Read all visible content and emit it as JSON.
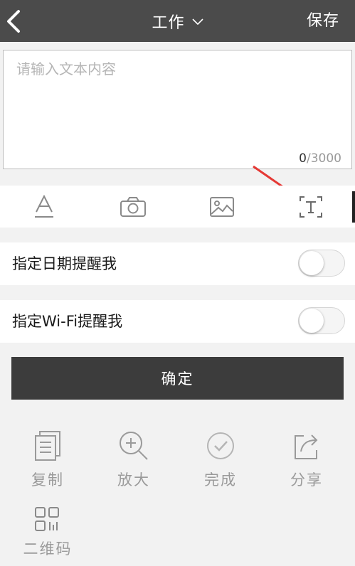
{
  "header": {
    "back_icon": "back-arrow-icon",
    "title": "工作",
    "title_dropdown_icon": "chevron-down-icon",
    "save_label": "保存"
  },
  "editor": {
    "placeholder": "请输入文本内容",
    "value": "",
    "counter_current": "0",
    "counter_max": "/3000"
  },
  "toolbar": {
    "items": [
      {
        "icon": "text-format-icon"
      },
      {
        "icon": "camera-icon"
      },
      {
        "icon": "image-icon"
      },
      {
        "icon": "text-recognition-icon"
      }
    ]
  },
  "settings": {
    "date_reminder_label": "指定日期提醒我",
    "date_reminder_on": false,
    "wifi_reminder_label": "指定Wi-Fi提醒我",
    "wifi_reminder_on": false
  },
  "confirm_label": "确定",
  "actions": [
    {
      "icon": "copy-icon",
      "label": "复制"
    },
    {
      "icon": "zoom-in-icon",
      "label": "放大"
    },
    {
      "icon": "check-circle-icon",
      "label": "完成"
    },
    {
      "icon": "share-icon",
      "label": "分享"
    },
    {
      "icon": "qr-code-icon",
      "label": "二维码"
    }
  ],
  "colors": {
    "header_bg": "#4b4b4b",
    "confirm_bg": "#3c3c3c",
    "annotation_arrow": "#e53935"
  }
}
